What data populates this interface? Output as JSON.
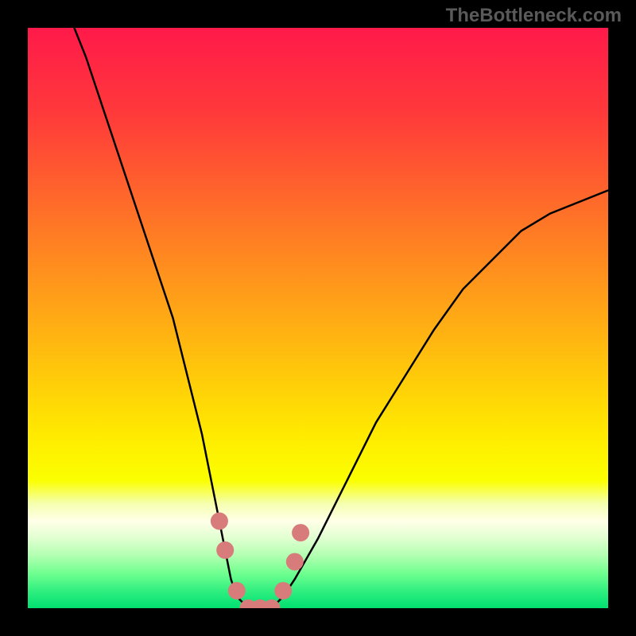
{
  "watermark": "TheBottleneck.com",
  "chart_data": {
    "type": "line",
    "title": "",
    "xlabel": "",
    "ylabel": "",
    "xlim": [
      0,
      100
    ],
    "ylim": [
      0,
      100
    ],
    "series": [
      {
        "name": "bottleneck-curve",
        "description": "V-shaped performance bottleneck curve",
        "x": [
          8,
          10,
          15,
          20,
          25,
          28,
          30,
          32,
          34,
          35,
          36,
          38,
          40,
          42,
          44,
          46,
          50,
          55,
          60,
          65,
          70,
          75,
          80,
          85,
          90,
          95,
          100
        ],
        "y": [
          100,
          95,
          80,
          65,
          50,
          38,
          30,
          20,
          10,
          5,
          2,
          0,
          0,
          0,
          2,
          5,
          12,
          22,
          32,
          40,
          48,
          55,
          60,
          65,
          68,
          70,
          72
        ]
      }
    ],
    "markers": {
      "description": "Highlighted data points near curve minimum",
      "color": "#d87b7b",
      "points": [
        {
          "x": 33,
          "y": 15
        },
        {
          "x": 34,
          "y": 10
        },
        {
          "x": 36,
          "y": 3
        },
        {
          "x": 38,
          "y": 0
        },
        {
          "x": 40,
          "y": 0
        },
        {
          "x": 42,
          "y": 0
        },
        {
          "x": 44,
          "y": 3
        },
        {
          "x": 46,
          "y": 8
        },
        {
          "x": 47,
          "y": 13
        }
      ]
    },
    "gradient_stops": [
      {
        "offset": 0,
        "color": "#ff1a4a"
      },
      {
        "offset": 15,
        "color": "#ff3a3a"
      },
      {
        "offset": 30,
        "color": "#ff6a2a"
      },
      {
        "offset": 45,
        "color": "#ff9a1a"
      },
      {
        "offset": 60,
        "color": "#ffca0a"
      },
      {
        "offset": 70,
        "color": "#ffea00"
      },
      {
        "offset": 78,
        "color": "#fbff00"
      },
      {
        "offset": 82,
        "color": "#f5ffb0"
      },
      {
        "offset": 85,
        "color": "#ffffe8"
      },
      {
        "offset": 88,
        "color": "#e0ffd0"
      },
      {
        "offset": 91,
        "color": "#b0ffb0"
      },
      {
        "offset": 94,
        "color": "#70ff90"
      },
      {
        "offset": 97,
        "color": "#30ef80"
      },
      {
        "offset": 100,
        "color": "#00df70"
      }
    ]
  }
}
